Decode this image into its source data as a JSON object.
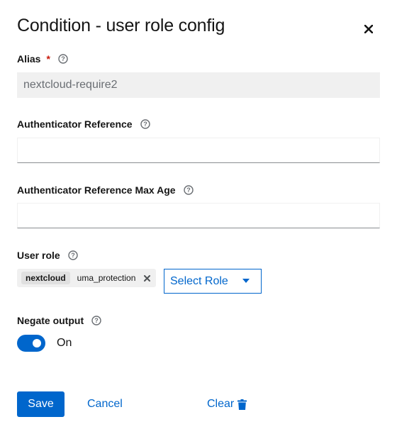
{
  "dialog": {
    "title": "Condition - user role config"
  },
  "fields": {
    "alias": {
      "label": "Alias",
      "required_mark": "*",
      "value": "nextcloud-require2"
    },
    "auth_ref": {
      "label": "Authenticator Reference",
      "value": ""
    },
    "auth_ref_max_age": {
      "label": "Authenticator Reference Max Age",
      "value": ""
    },
    "user_role": {
      "label": "User role",
      "chip_group": "nextcloud",
      "chip": "uma_protection",
      "select_placeholder": "Select Role"
    },
    "negate": {
      "label": "Negate output",
      "state_label": "On",
      "checked": true
    }
  },
  "actions": {
    "save": "Save",
    "cancel": "Cancel",
    "clear": "Clear"
  },
  "colors": {
    "primary": "#0066cc",
    "required": "#c9190b"
  }
}
